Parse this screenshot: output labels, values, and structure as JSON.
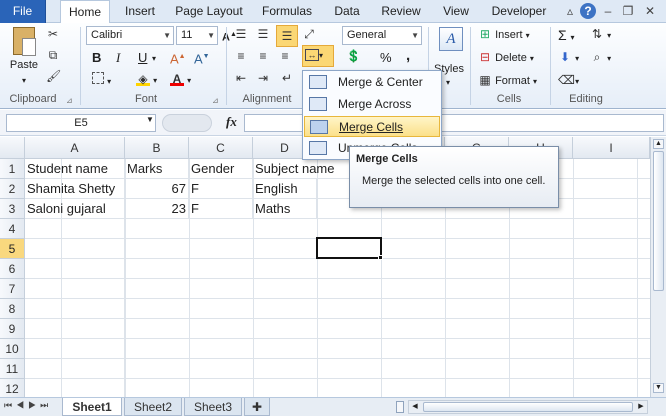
{
  "tabs": [
    "File",
    "Home",
    "Insert",
    "Page Layout",
    "Formulas",
    "Data",
    "Review",
    "View",
    "Developer"
  ],
  "ribbon": {
    "paste_label": "Paste",
    "clipboard_label": "Clipboard",
    "font_label": "Font",
    "alignment_label": "Alignment",
    "styles_label": "Styles",
    "cells_label": "Cells",
    "editing_label": "Editing",
    "font_name": "Calibri",
    "font_size": "11",
    "number_format": "General",
    "insert_label": "Insert",
    "delete_label": "Delete",
    "format_label": "Format",
    "bold": "B",
    "italic": "I",
    "underline": "U",
    "percent": "%",
    "comma": ","
  },
  "formula_bar": {
    "name_box": "E5",
    "fx": "fx"
  },
  "columns": [
    "A",
    "B",
    "C",
    "D",
    "E",
    "F",
    "G",
    "H",
    "I"
  ],
  "rows": [
    "1",
    "2",
    "3",
    "4",
    "5",
    "6",
    "7",
    "8",
    "9",
    "10",
    "11",
    "12"
  ],
  "cells": {
    "a1": "Student name",
    "b1": "Marks",
    "c1": "Gender",
    "d1": "Subject name",
    "a2": "Shamita Shetty",
    "b2": "67",
    "c2": "F",
    "d2": "English",
    "a3": "Saloni gujaral",
    "b3": "23",
    "c3": "F",
    "d3": "Maths"
  },
  "merge_menu": {
    "items": [
      "Merge & Center",
      "Merge Across",
      "Merge Cells",
      "Unmerge Cells"
    ]
  },
  "tooltip": {
    "title": "Merge Cells",
    "body": "Merge the selected cells into one cell."
  },
  "sheets": [
    "Sheet1",
    "Sheet2",
    "Sheet3"
  ]
}
